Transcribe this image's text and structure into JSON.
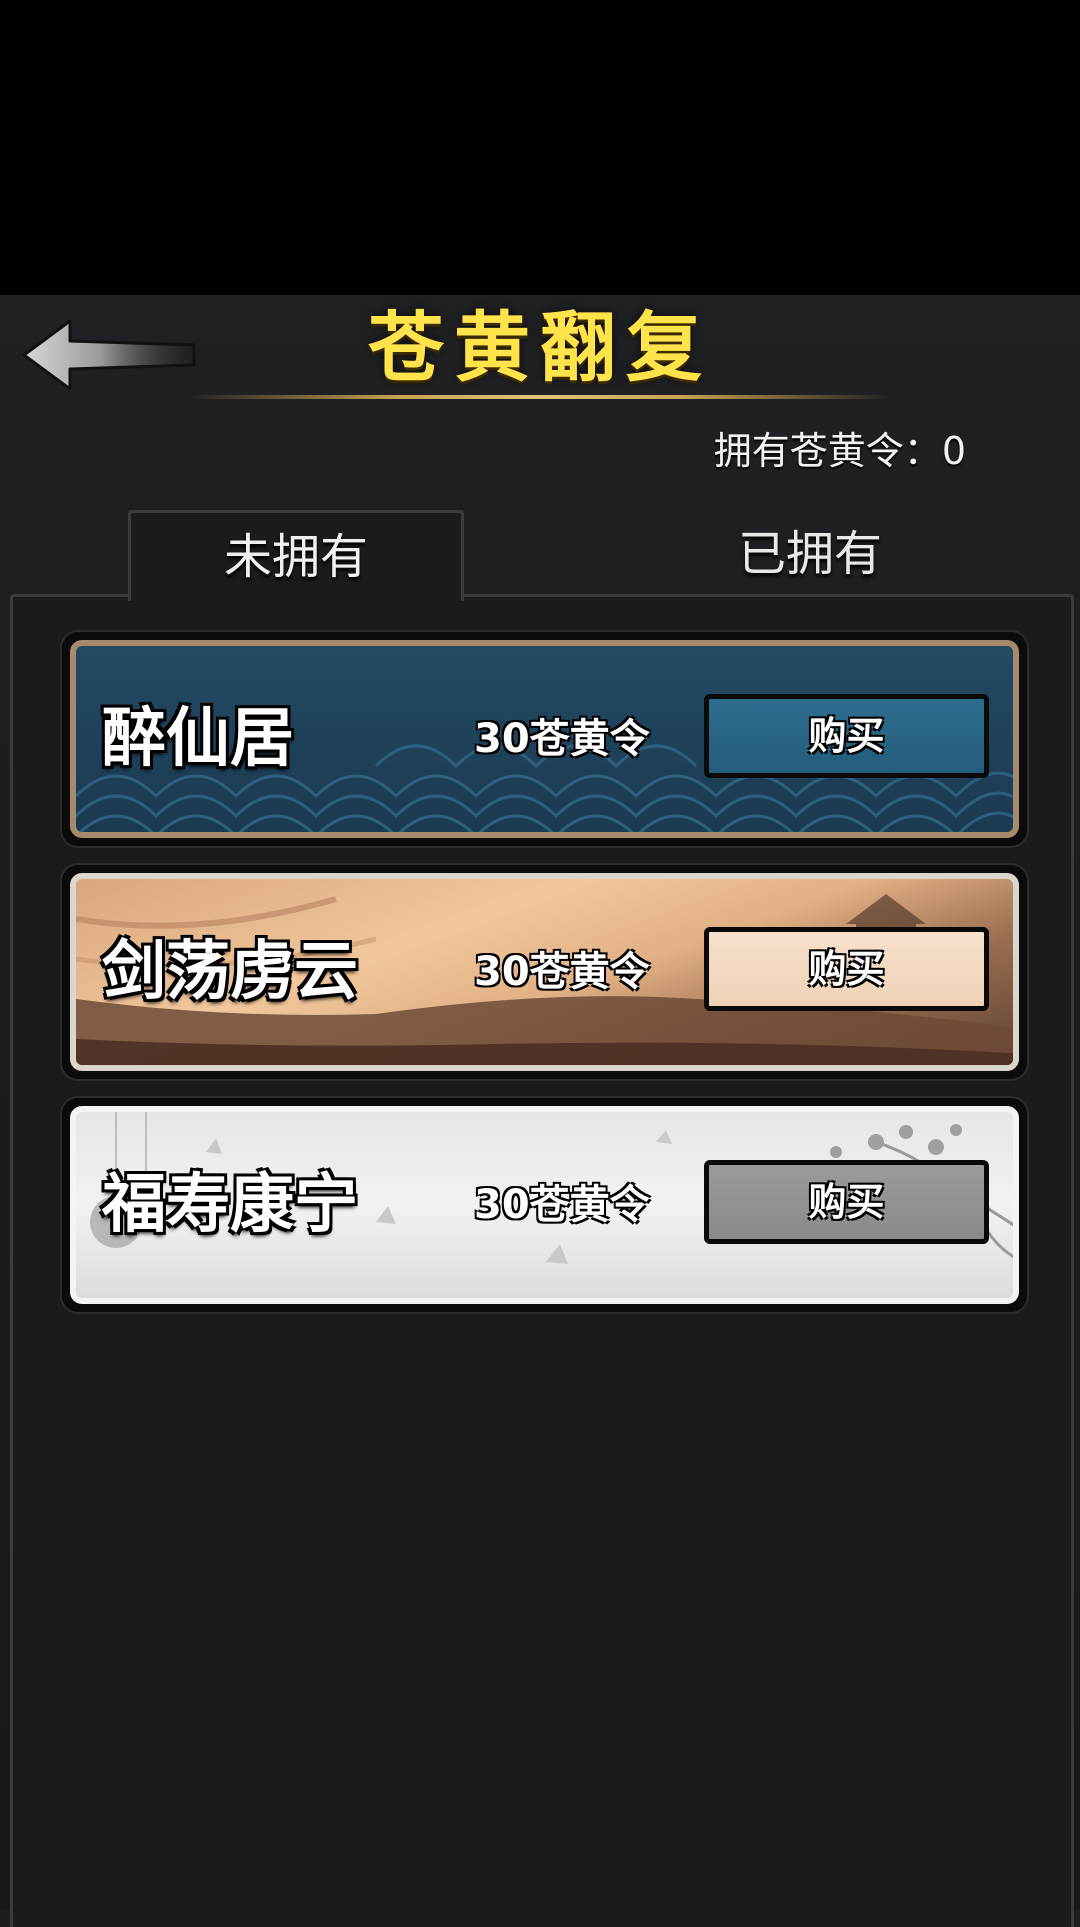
{
  "header": {
    "title": "苍黄翻复",
    "token_label": "拥有苍黄令：",
    "token_count": "0"
  },
  "tabs": [
    {
      "label": "未拥有",
      "active": true
    },
    {
      "label": "已拥有",
      "active": false
    }
  ],
  "items": [
    {
      "name": "醉仙居",
      "price": "30苍黄令",
      "buy_label": "购买",
      "theme": "waves-blue"
    },
    {
      "name": "剑荡虏云",
      "price": "30苍黄令",
      "buy_label": "购买",
      "theme": "sunset-pagoda"
    },
    {
      "name": "福寿康宁",
      "price": "30苍黄令",
      "buy_label": "购买",
      "theme": "plum-blossom-white"
    }
  ],
  "colors": {
    "title_gold": "#ffe34a",
    "background": "#1c1d1f",
    "card1_frame": "#a68a6c",
    "card2_frame": "#d9d6d0",
    "card3_frame": "#f4f4f4"
  },
  "icons": {
    "back": "back-arrow-icon"
  }
}
